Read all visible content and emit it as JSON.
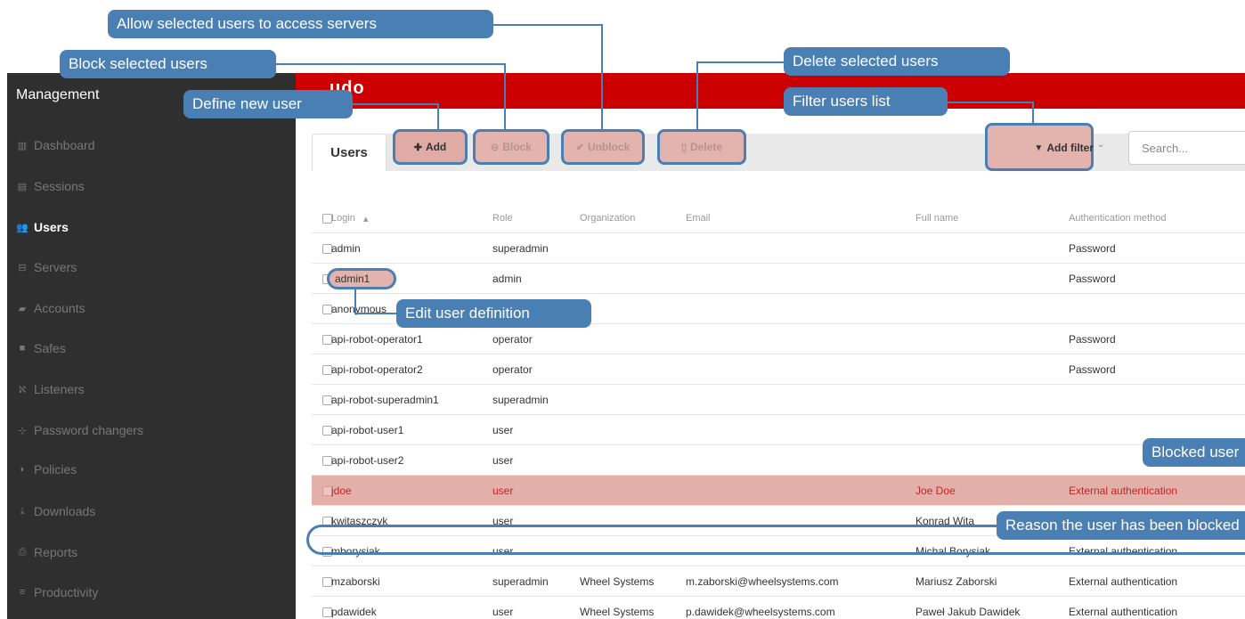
{
  "brand": {
    "logo_text": "udo",
    "accent": "#cc0000",
    "callout_color": "#4a7fb3",
    "highlight": "#e3b3ad"
  },
  "sidebar": {
    "title": "Management",
    "items": [
      {
        "label": "Dashboard",
        "icon": "chart-icon",
        "glyph": "▥",
        "active": false
      },
      {
        "label": "Sessions",
        "icon": "film-icon",
        "glyph": "▤",
        "active": false
      },
      {
        "label": "Users",
        "icon": "users-icon",
        "glyph": "👥",
        "active": true
      },
      {
        "label": "Servers",
        "icon": "server-icon",
        "glyph": "⊟",
        "active": false
      },
      {
        "label": "Accounts",
        "icon": "book-icon",
        "glyph": "▰",
        "active": false
      },
      {
        "label": "Safes",
        "icon": "safe-icon",
        "glyph": "■",
        "active": false
      },
      {
        "label": "Listeners",
        "icon": "rss-icon",
        "glyph": "ℵ",
        "active": false
      },
      {
        "label": "Password changers",
        "icon": "sitemap-icon",
        "glyph": "⊹",
        "active": false
      },
      {
        "label": "Policies",
        "icon": "shield-icon",
        "glyph": "◗",
        "active": false
      },
      {
        "label": "Downloads",
        "icon": "download-icon",
        "glyph": "⤓",
        "active": false
      },
      {
        "label": "Reports",
        "icon": "print-icon",
        "glyph": "⎙",
        "active": false
      },
      {
        "label": "Productivity",
        "icon": "list-icon",
        "glyph": "≡",
        "active": false
      }
    ]
  },
  "toolbar": {
    "tab_label": "Users",
    "add_label": "Add",
    "block_label": "Block",
    "unblock_label": "Unblock",
    "delete_label": "Delete",
    "filter_label": "Add filter",
    "search_placeholder": "Search..."
  },
  "table": {
    "headers": [
      "Login",
      "Role",
      "Organization",
      "Email",
      "Full name",
      "Authentication method"
    ],
    "rows": [
      {
        "login": "admin",
        "role": "superadmin",
        "org": "",
        "email": "",
        "fullname": "",
        "auth": "Password",
        "blocked": false
      },
      {
        "login": "admin1",
        "role": "admin",
        "org": "",
        "email": "",
        "fullname": "",
        "auth": "Password",
        "blocked": false
      },
      {
        "login": "anonymous",
        "role": "",
        "org": "",
        "email": "",
        "fullname": "",
        "auth": "",
        "blocked": false
      },
      {
        "login": "api-robot-operator1",
        "role": "operator",
        "org": "",
        "email": "",
        "fullname": "",
        "auth": "Password",
        "blocked": false
      },
      {
        "login": "api-robot-operator2",
        "role": "operator",
        "org": "",
        "email": "",
        "fullname": "",
        "auth": "Password",
        "blocked": false
      },
      {
        "login": "api-robot-superadmin1",
        "role": "superadmin",
        "org": "",
        "email": "",
        "fullname": "",
        "auth": "",
        "blocked": false
      },
      {
        "login": "api-robot-user1",
        "role": "user",
        "org": "",
        "email": "",
        "fullname": "",
        "auth": "",
        "blocked": false
      },
      {
        "login": "api-robot-user2",
        "role": "user",
        "org": "",
        "email": "",
        "fullname": "",
        "auth": "",
        "blocked": false
      },
      {
        "login": "jdoe",
        "role": "user",
        "org": "",
        "email": "",
        "fullname": "Joe Doe",
        "auth": "External authentication",
        "blocked": true
      },
      {
        "login": "kwitaszczyk",
        "role": "user",
        "org": "",
        "email": "",
        "fullname": "Konrad Wita",
        "auth": "",
        "blocked": false
      },
      {
        "login": "mborysiak",
        "role": "user",
        "org": "",
        "email": "",
        "fullname": "Michal Borysiak",
        "auth": "External authentication",
        "blocked": false
      },
      {
        "login": "mzaborski",
        "role": "superadmin",
        "org": "Wheel Systems",
        "email": "m.zaborski@wheelsystems.com",
        "fullname": "Mariusz Zaborski",
        "auth": "External authentication",
        "blocked": false
      },
      {
        "login": "pdawidek",
        "role": "user",
        "org": "Wheel Systems",
        "email": "p.dawidek@wheelsystems.com",
        "fullname": "Paweł Jakub Dawidek",
        "auth": "External authentication",
        "blocked": false
      }
    ]
  },
  "callouts": {
    "allow_access": "Allow selected users to access servers",
    "block_users": "Block selected users",
    "define_user": "Define new user",
    "delete_users": "Delete selected users",
    "filter_list": "Filter users list",
    "edit_user": "Edit user definition",
    "blocked_user": "Blocked user",
    "block_reason": "Reason the user has been blocked"
  }
}
